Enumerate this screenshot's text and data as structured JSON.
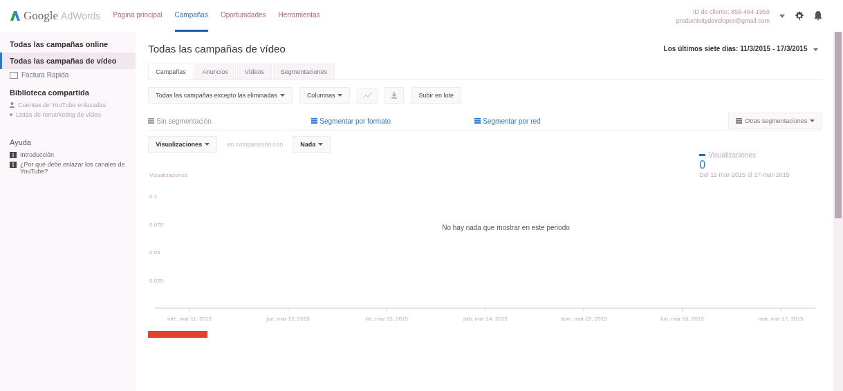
{
  "header": {
    "logo": {
      "brand": "Google",
      "product": "AdWords"
    },
    "nav": [
      {
        "label": "Página principal",
        "selected": false
      },
      {
        "label": "Campañas",
        "selected": true
      },
      {
        "label": "Oportunidades",
        "selected": false
      },
      {
        "label": "Herramientas",
        "selected": false
      }
    ],
    "account": {
      "client_id": "ID de cliente: 856-464-1959",
      "email": "productivitydeveloper@gmail.com"
    }
  },
  "sidebar": {
    "items": [
      {
        "kind": "nav",
        "label": "Todas las campañas online",
        "selected": false
      },
      {
        "kind": "nav",
        "label": "Todas las campañas de vídeo",
        "selected": true
      },
      {
        "kind": "tool",
        "label": "Factura Rapida",
        "selected": false
      },
      {
        "kind": "heading",
        "label": "Biblioteca compartida",
        "selected": false
      },
      {
        "kind": "user-link",
        "label": "Cuentas de YouTube enlazadas",
        "selected": false
      },
      {
        "kind": "list-link",
        "label": "Listas de remarketing de vídeo",
        "selected": false
      },
      {
        "kind": "help-heading",
        "label": "Ayuda",
        "selected": false
      },
      {
        "kind": "help-link",
        "label": "Introducción",
        "selected": false
      },
      {
        "kind": "help-link",
        "label": "¿Por qué debe enlazar los canales de YouTube?",
        "selected": false
      }
    ]
  },
  "main": {
    "title": "Todas las campañas de vídeo",
    "date_range": "Los últimos siete días: 11/3/2015 - 17/3/2015",
    "tabs": [
      {
        "label": "Campañas",
        "selected": true
      },
      {
        "label": "Anuncios",
        "selected": false
      },
      {
        "label": "Vídeos",
        "selected": false
      },
      {
        "label": "Segmentaciones",
        "selected": false
      }
    ],
    "toolbar": {
      "filter": "Todas las campañas excepto las eliminadas",
      "columns": "Columnas",
      "bulk_upload": "Subir en lote"
    },
    "segments": [
      {
        "label": "Sin segmentación",
        "selected": true
      },
      {
        "label": "Segmentar por formato",
        "selected": false
      },
      {
        "label": "Segmentar por red",
        "selected": false
      }
    ],
    "other_segments": "Otras segmentaciones",
    "metric": "Visualizaciones",
    "compare_label": "en comparación con",
    "compare_metric": "Nada",
    "legend": {
      "label": "Visualizaciones",
      "color": "#1a73c8",
      "total": "0",
      "period": "Del 11-mar-2015 al 17-mar-2015"
    },
    "chart_data": {
      "type": "line",
      "ylabel": "Visualizaciones",
      "categories": [
        "mié, mar 11, 2015",
        "jue, mar 12, 2015",
        "vie, mar 13, 2015",
        "sáb, mar 14, 2015",
        "dom, mar 15, 2015",
        "lun, mar 16, 2015",
        "mar, mar 17, 2015"
      ],
      "ylim": [
        0,
        0.1
      ],
      "yticks": [
        0.025,
        0.05,
        0.075,
        0.1
      ],
      "annotations": [
        "No hay nada que mostrar en este periodo"
      ]
    }
  }
}
